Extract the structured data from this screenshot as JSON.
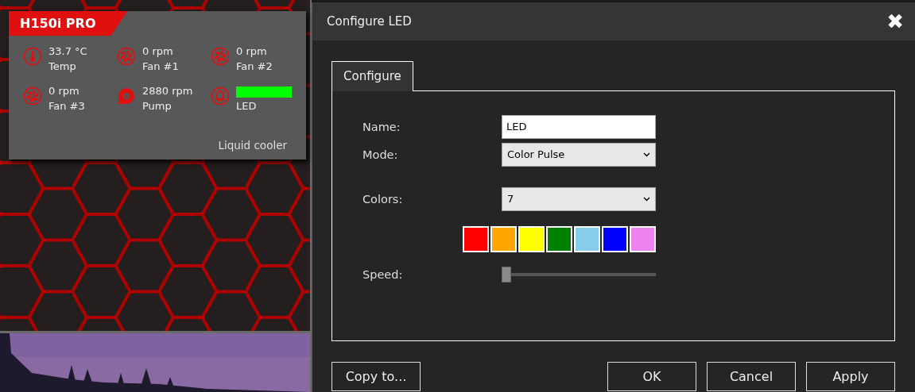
{
  "device_card": {
    "title": "H150i PRO",
    "footer": "Liquid cooler",
    "sensors": [
      {
        "kind": "temp",
        "value": "33.7 °C",
        "label": "Temp"
      },
      {
        "kind": "fan",
        "value": "0 rpm",
        "label": "Fan #1"
      },
      {
        "kind": "fan",
        "value": "0 rpm",
        "label": "Fan #2"
      },
      {
        "kind": "fan",
        "value": "0 rpm",
        "label": "Fan #3"
      },
      {
        "kind": "pump",
        "value": "2880 rpm",
        "label": "Pump"
      },
      {
        "kind": "led",
        "color": "#00ff00",
        "label": "LED"
      }
    ]
  },
  "dialog": {
    "title": "Configure LED",
    "close": "✖",
    "tabs": [
      {
        "label": "Configure",
        "selected": true
      }
    ],
    "fields": [
      {
        "kind": "text",
        "label": "Name:",
        "value": "LED"
      },
      {
        "kind": "select",
        "label": "Mode:",
        "value": "Color Pulse"
      },
      {
        "kind": "select",
        "label": "Colors:",
        "value": "7"
      },
      {
        "kind": "swatches",
        "colors": [
          {
            "color": "#ff0000"
          },
          {
            "color": "#ffa500"
          },
          {
            "color": "#ffff00"
          },
          {
            "color": "#008000"
          },
          {
            "color": "#87ceeb"
          },
          {
            "color": "#0000ff"
          },
          {
            "color": "#ee82ee"
          }
        ]
      },
      {
        "kind": "slider",
        "label": "Speed:",
        "level": 0
      }
    ],
    "left_buttons": [
      {
        "label": "Copy to..."
      }
    ],
    "right_buttons": [
      {
        "label": "OK"
      },
      {
        "label": "Cancel"
      },
      {
        "label": "Apply"
      }
    ]
  }
}
